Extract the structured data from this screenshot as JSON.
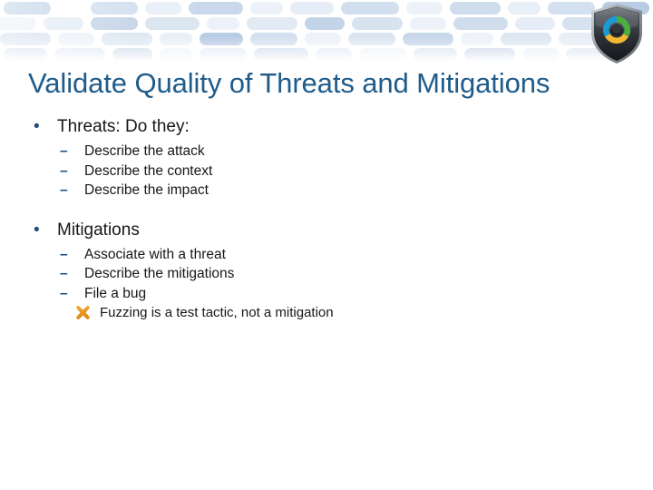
{
  "slide": {
    "title": "Validate Quality of Threats and Mitigations",
    "logo": {
      "name": "sdl-threat-modeling-shield-logo",
      "shield_color": "#3a3f45",
      "segment_blue": "#1a9ad6",
      "segment_green": "#4caf3f",
      "segment_yellow": "#f4b731"
    },
    "colors": {
      "title": "#1F5C8B",
      "bullet_marker": "#1F4E79",
      "body_text": "#171717",
      "x_marker": "#E8962A",
      "banner_light": "#EDF2F8",
      "banner_mid": "#DCE6F1",
      "banner_dark": "#B8CCE4"
    },
    "markers": {
      "level1": "•",
      "level2": "–",
      "level3_icon": "orange-x-icon"
    },
    "content": [
      {
        "level": 1,
        "text": "Threats: Do they:",
        "children": [
          {
            "level": 2,
            "text": "Describe the attack"
          },
          {
            "level": 2,
            "text": "Describe the context"
          },
          {
            "level": 2,
            "text": "Describe the impact"
          }
        ]
      },
      {
        "level": 1,
        "text": "Mitigations",
        "children": [
          {
            "level": 2,
            "text": "Associate with a threat"
          },
          {
            "level": 2,
            "text": "Describe the mitigations"
          },
          {
            "level": 2,
            "text": "File a bug"
          },
          {
            "level": 3,
            "text": "Fuzzing is a test tactic, not a mitigation"
          }
        ]
      }
    ]
  }
}
